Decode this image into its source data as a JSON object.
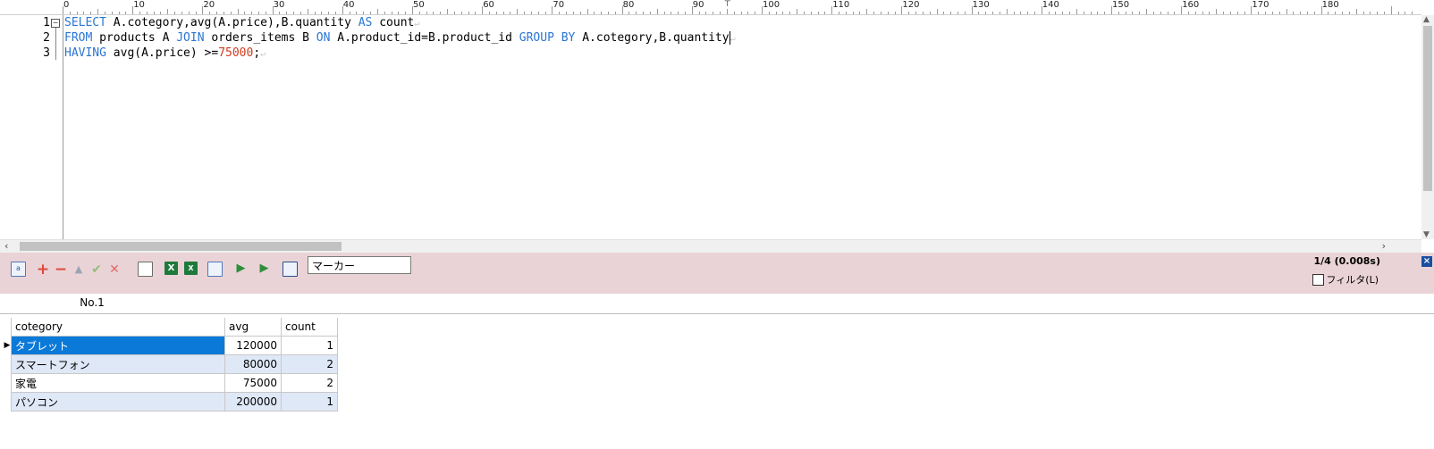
{
  "ruler": {
    "labels": [
      "0",
      "10",
      "20",
      "30",
      "40",
      "50",
      "60",
      "70",
      "80",
      "90",
      "100",
      "110",
      "120",
      "130",
      "140",
      "150",
      "160",
      "170",
      "180"
    ],
    "caret": "⊤"
  },
  "editor": {
    "line_numbers": [
      "1",
      "2",
      "3"
    ],
    "fold_glyph": "−",
    "lines": [
      [
        {
          "t": "SELECT",
          "k": "kw"
        },
        {
          "t": " A.cotegory,avg(A.price),B.quantity "
        },
        {
          "t": "AS",
          "k": "kw"
        },
        {
          "t": " count"
        },
        {
          "t": "↵",
          "k": "eol"
        }
      ],
      [
        {
          "t": "FROM",
          "k": "kw"
        },
        {
          "t": " products A "
        },
        {
          "t": "JOIN",
          "k": "kw"
        },
        {
          "t": " orders_items B "
        },
        {
          "t": "ON",
          "k": "kw"
        },
        {
          "t": " A.product_id=B.product_id "
        },
        {
          "t": "GROUP BY",
          "k": "kw"
        },
        {
          "t": " A.cotegory,B.quantity"
        },
        {
          "t": "",
          "k": "cursor"
        },
        {
          "t": "↵",
          "k": "eol"
        }
      ],
      [
        {
          "t": "HAVING",
          "k": "kw"
        },
        {
          "t": " avg(A.price) >="
        },
        {
          "t": "75000",
          "k": "num-lit"
        },
        {
          "t": ";"
        },
        {
          "t": "↵",
          "k": "eol"
        }
      ]
    ]
  },
  "toolbar": {
    "marker_value": "マーカー",
    "status": "1/4 (0.008s)",
    "filter_label": "フィルタ(L)",
    "close_glyph": "×"
  },
  "results": {
    "tab_label": "No.1",
    "columns": [
      "cotegory",
      "avg",
      "count"
    ],
    "rows": [
      [
        "タブレット",
        "120000",
        "1"
      ],
      [
        "スマートフォン",
        "80000",
        "2"
      ],
      [
        "家電",
        "75000",
        "2"
      ],
      [
        "パソコン",
        "200000",
        "1"
      ]
    ],
    "current_row_marker": "▶"
  },
  "colors": {
    "keyword": "#2a76d4",
    "number": "#d23a1e",
    "toolbar_bg": "#ead3d6",
    "selected_cell": "#0a79d8",
    "alt_row": "#dfe8f7"
  }
}
